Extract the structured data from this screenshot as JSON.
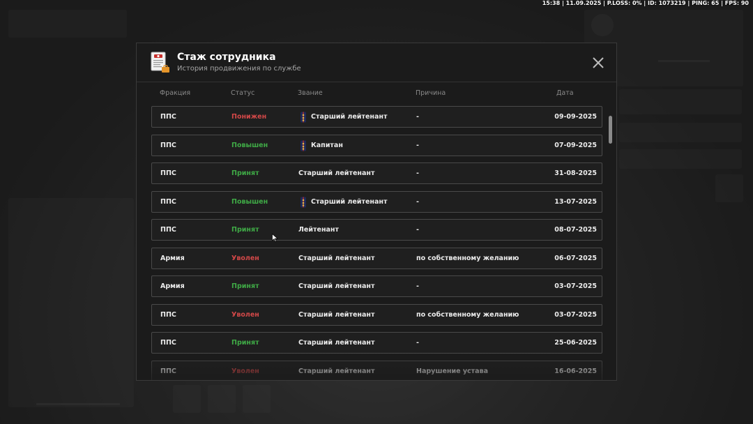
{
  "status_bar": "15:38 | 11.09.2025 | P.LOSS: 0% | ID: 1073219 | PING: 65 | FPS: 90",
  "modal": {
    "title": "Стаж сотрудника",
    "subtitle": "История продвижения по службе",
    "close_icon": "close-icon",
    "doc_icon": "document-icon"
  },
  "columns": {
    "faction": "Фракция",
    "status": "Статус",
    "rank": "Звание",
    "reason": "Причина",
    "date": "Дата"
  },
  "colors": {
    "status_negative": "#d24848",
    "status_positive": "#3faa46"
  },
  "rows": [
    {
      "faction": "ППС",
      "status": "Понижен",
      "status_type": "negative",
      "rank": "Старший лейтенант",
      "rank_icon": true,
      "reason": "-",
      "date": "09-09-2025"
    },
    {
      "faction": "ППС",
      "status": "Повышен",
      "status_type": "positive",
      "rank": "Капитан",
      "rank_icon": true,
      "reason": "-",
      "date": "07-09-2025"
    },
    {
      "faction": "ППС",
      "status": "Принят",
      "status_type": "positive",
      "rank": "Старший лейтенант",
      "rank_icon": false,
      "reason": "-",
      "date": "31-08-2025"
    },
    {
      "faction": "ППС",
      "status": "Повышен",
      "status_type": "positive",
      "rank": "Старший лейтенант",
      "rank_icon": true,
      "reason": "-",
      "date": "13-07-2025"
    },
    {
      "faction": "ППС",
      "status": "Принят",
      "status_type": "positive",
      "rank": "Лейтенант",
      "rank_icon": false,
      "reason": "-",
      "date": "08-07-2025"
    },
    {
      "faction": "Армия",
      "status": "Уволен",
      "status_type": "negative",
      "rank": "Старший лейтенант",
      "rank_icon": false,
      "reason": "по собственному желанию",
      "date": "06-07-2025"
    },
    {
      "faction": "Армия",
      "status": "Принят",
      "status_type": "positive",
      "rank": "Старший лейтенант",
      "rank_icon": false,
      "reason": "-",
      "date": "03-07-2025"
    },
    {
      "faction": "ППС",
      "status": "Уволен",
      "status_type": "negative",
      "rank": "Старший лейтенант",
      "rank_icon": false,
      "reason": "по собственному желанию",
      "date": "03-07-2025"
    },
    {
      "faction": "ППС",
      "status": "Принят",
      "status_type": "positive",
      "rank": "Старший лейтенант",
      "rank_icon": false,
      "reason": "-",
      "date": "25-06-2025"
    },
    {
      "faction": "ППС",
      "status": "Уволен",
      "status_type": "negative",
      "rank": "Старший лейтенант",
      "rank_icon": false,
      "reason": "Нарушение устава",
      "date": "16-06-2025"
    }
  ]
}
